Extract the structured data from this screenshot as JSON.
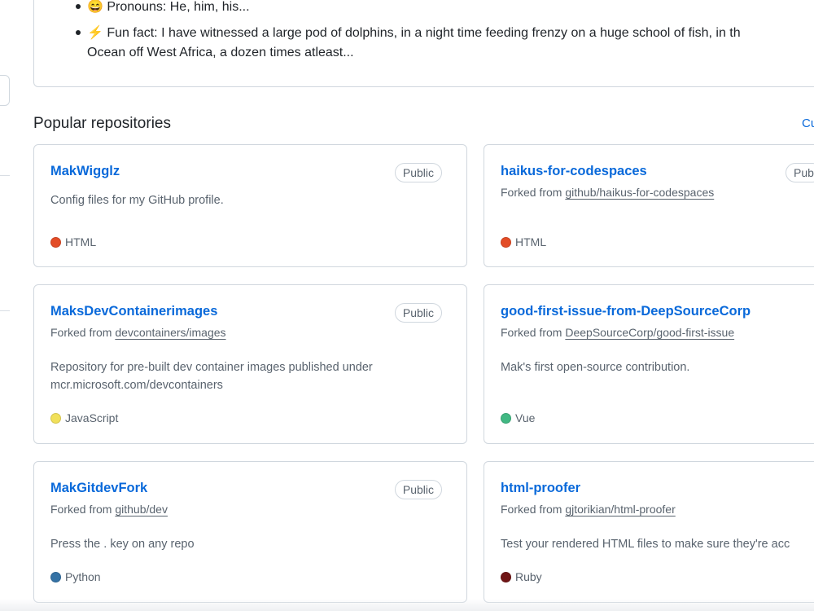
{
  "readme": {
    "pronouns": "😄 Pronouns: He, him, his...",
    "fun_fact_line1": "⚡ Fun fact: I have witnessed a large pod of dolphins, in a night time feeding frenzy on a huge school of fish, in th",
    "fun_fact_line2": "Ocean off West Africa, a dozen times atleast..."
  },
  "section": {
    "title": "Popular repositories",
    "customize": "Cu"
  },
  "colors": {
    "link": "#0969da",
    "html": "#e34c26",
    "javascript": "#f1e05a",
    "vue": "#41b883",
    "python": "#3572A5",
    "ruby": "#701516"
  },
  "repos": [
    {
      "name": "MakWigglz",
      "visibility": "Public",
      "forked_prefix": "",
      "forked_from": "",
      "description": "Config files for my GitHub profile.",
      "language": "HTML",
      "language_color": "#e34c26"
    },
    {
      "name": "haikus-for-codespaces",
      "visibility": "Pub",
      "forked_prefix": "Forked from",
      "forked_from": "github/haikus-for-codespaces",
      "description": "",
      "language": "HTML",
      "language_color": "#e34c26"
    },
    {
      "name": "MaksDevContainerimages",
      "visibility": "Public",
      "forked_prefix": "Forked from",
      "forked_from": "devcontainers/images",
      "description": "Repository for pre-built dev container images published under mcr.microsoft.com/devcontainers",
      "language": "JavaScript",
      "language_color": "#f1e05a"
    },
    {
      "name": "good-first-issue-from-DeepSourceCorp",
      "visibility": "",
      "forked_prefix": "Forked from",
      "forked_from": "DeepSourceCorp/good-first-issue",
      "description": "Mak's first open-source contribution.",
      "language": "Vue",
      "language_color": "#41b883"
    },
    {
      "name": "MakGitdevFork",
      "visibility": "Public",
      "forked_prefix": "Forked from",
      "forked_from": "github/dev",
      "description": "Press the . key on any repo",
      "language": "Python",
      "language_color": "#3572A5"
    },
    {
      "name": "html-proofer",
      "visibility": "",
      "forked_prefix": "Forked from",
      "forked_from": "gjtorikian/html-proofer",
      "description": "Test your rendered HTML files to make sure they're acc",
      "language": "Ruby",
      "language_color": "#701516"
    }
  ]
}
